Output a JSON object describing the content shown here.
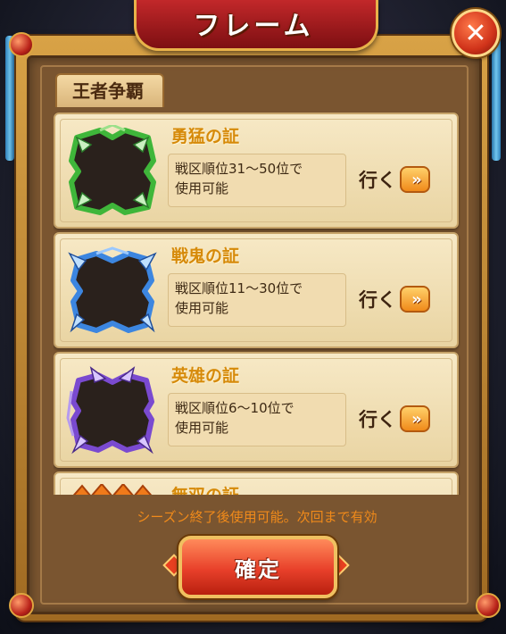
{
  "window": {
    "title": "フレーム",
    "close_label": "✕"
  },
  "tab": {
    "label": "王者争覇"
  },
  "frames": [
    {
      "name": "勇猛の証",
      "desc_line1": "戦区順位31〜50位で",
      "desc_line2": "使用可能",
      "go_label": "行く",
      "color": "#3fb63a",
      "icon": "green-thorn-frame-icon"
    },
    {
      "name": "戦鬼の証",
      "desc_line1": "戦区順位11〜30位で",
      "desc_line2": "使用可能",
      "go_label": "行く",
      "color": "#3c86e0",
      "icon": "blue-horned-frame-icon"
    },
    {
      "name": "英雄の証",
      "desc_line1": "戦区順位6〜10位で",
      "desc_line2": "使用可能",
      "go_label": "行く",
      "color": "#7a4ad0",
      "icon": "purple-horned-frame-icon"
    },
    {
      "name": "無双の証",
      "color": "#f07a1a",
      "icon": "orange-flame-frame-icon"
    }
  ],
  "footer": {
    "note": "シーズン終了後使用可能。次回まで有効"
  },
  "confirm": {
    "label": "確定"
  },
  "arrows_glyph": "»"
}
